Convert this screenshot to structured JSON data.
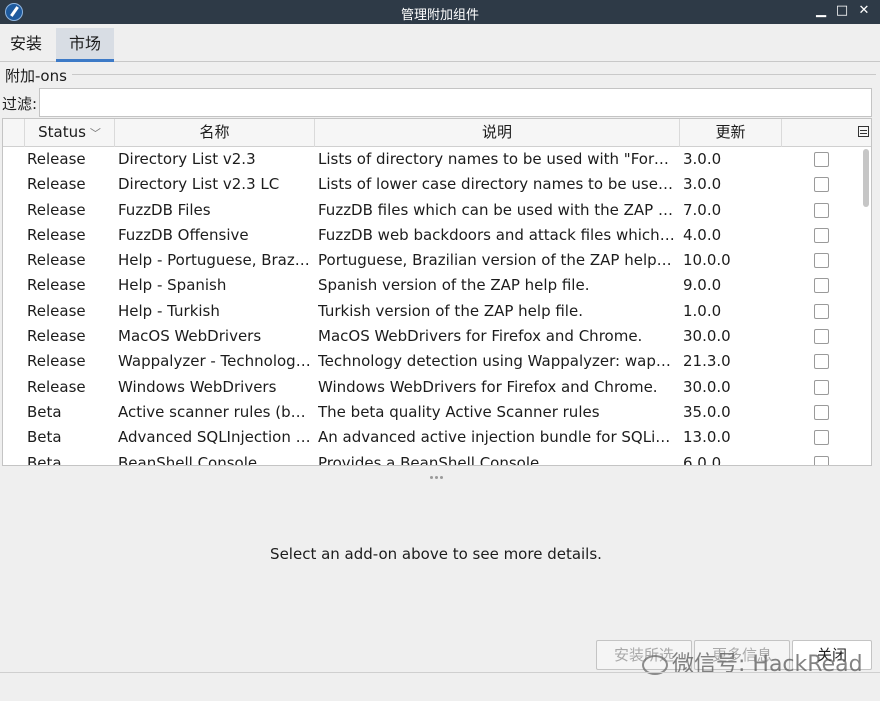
{
  "window": {
    "title": "管理附加组件",
    "minimize": "▁",
    "maximize": "□",
    "close": "✕"
  },
  "tabs": [
    {
      "label": "安装"
    },
    {
      "label": "市场",
      "selected": true
    }
  ],
  "group_title": "附加-ons",
  "filter": {
    "label": "过滤:",
    "value": ""
  },
  "table": {
    "headers": {
      "status": "Status",
      "name": "名称",
      "description": "说明",
      "update": "更新",
      "select": ""
    },
    "rows": [
      {
        "status": "Release",
        "name": "Directory List v2.3",
        "desc": "Lists of directory names to be used with \"Forced Browse\"",
        "ver": "3.0.0"
      },
      {
        "status": "Release",
        "name": "Directory List v2.3 LC",
        "desc": "Lists of lower case directory names to be used with \"Forced Browse\"",
        "ver": "3.0.0"
      },
      {
        "status": "Release",
        "name": "FuzzDB Files",
        "desc": "FuzzDB files which can be used with the ZAP fuzzer",
        "ver": "7.0.0"
      },
      {
        "status": "Release",
        "name": "FuzzDB Offensive",
        "desc": "FuzzDB web backdoors and attack files which can be used",
        "ver": "4.0.0"
      },
      {
        "status": "Release",
        "name": "Help - Portuguese, Brazilian",
        "desc": "Portuguese, Brazilian version of the ZAP help file.",
        "ver": "10.0.0"
      },
      {
        "status": "Release",
        "name": "Help - Spanish",
        "desc": "Spanish version of the ZAP help file.",
        "ver": "9.0.0"
      },
      {
        "status": "Release",
        "name": "Help - Turkish",
        "desc": "Turkish version of the ZAP help file.",
        "ver": "1.0.0"
      },
      {
        "status": "Release",
        "name": "MacOS WebDrivers",
        "desc": "MacOS WebDrivers for Firefox and Chrome.",
        "ver": "30.0.0"
      },
      {
        "status": "Release",
        "name": "Wappalyzer - Technology Detection",
        "desc": "Technology detection using Wappalyzer: wappalyzer.com",
        "ver": "21.3.0"
      },
      {
        "status": "Release",
        "name": "Windows WebDrivers",
        "desc": "Windows WebDrivers for Firefox and Chrome.",
        "ver": "30.0.0"
      },
      {
        "status": "Beta",
        "name": "Active scanner rules (beta)",
        "desc": "The beta quality Active Scanner rules",
        "ver": "35.0.0"
      },
      {
        "status": "Beta",
        "name": "Advanced SQLInjection Scanner",
        "desc": "An advanced active injection bundle for SQLi (derived by",
        "ver": "13.0.0"
      },
      {
        "status": "Beta",
        "name": "BeanShell Console",
        "desc": "Provides a BeanShell Console",
        "ver": "6.0.0"
      }
    ]
  },
  "details_placeholder": "Select an add-on above to see more details.",
  "buttons": {
    "install": "安装所选",
    "more_info": "更多信息",
    "close": "关闭"
  },
  "watermark": "微信号: HackRead"
}
